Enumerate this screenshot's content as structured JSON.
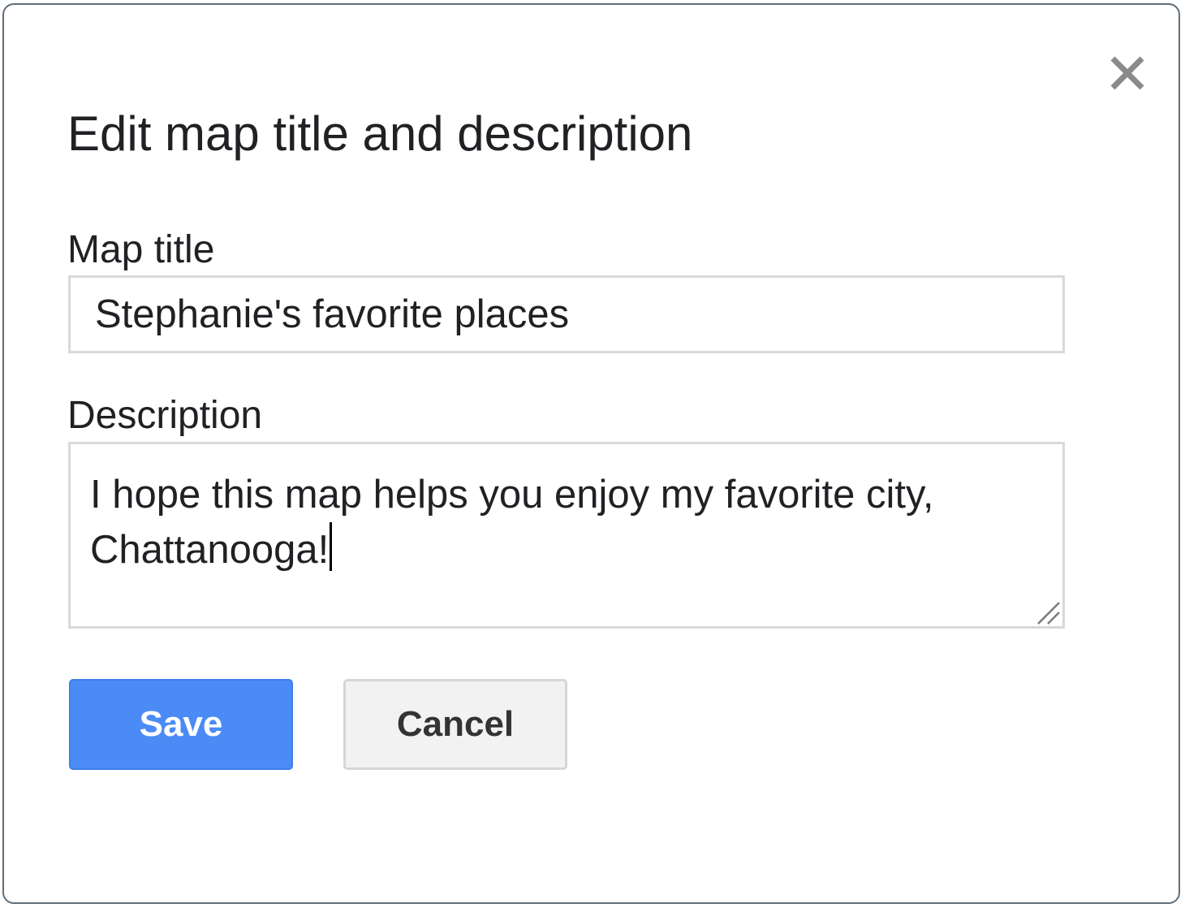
{
  "dialog": {
    "title": "Edit map title and description",
    "close_icon": "close-icon"
  },
  "map_title": {
    "label": "Map title",
    "value": "Stephanie's favorite places"
  },
  "description": {
    "label": "Description",
    "value": "I hope this map helps you enjoy my favorite city, Chattanooga!",
    "resize_icon": "resize-grip-icon"
  },
  "buttons": {
    "save_label": "Save",
    "cancel_label": "Cancel"
  },
  "colors": {
    "save_button": "#4b8bf5",
    "cancel_button": "#f2f2f2",
    "dialog_border": "#5f6e7a",
    "field_border": "#d9d9d9"
  }
}
